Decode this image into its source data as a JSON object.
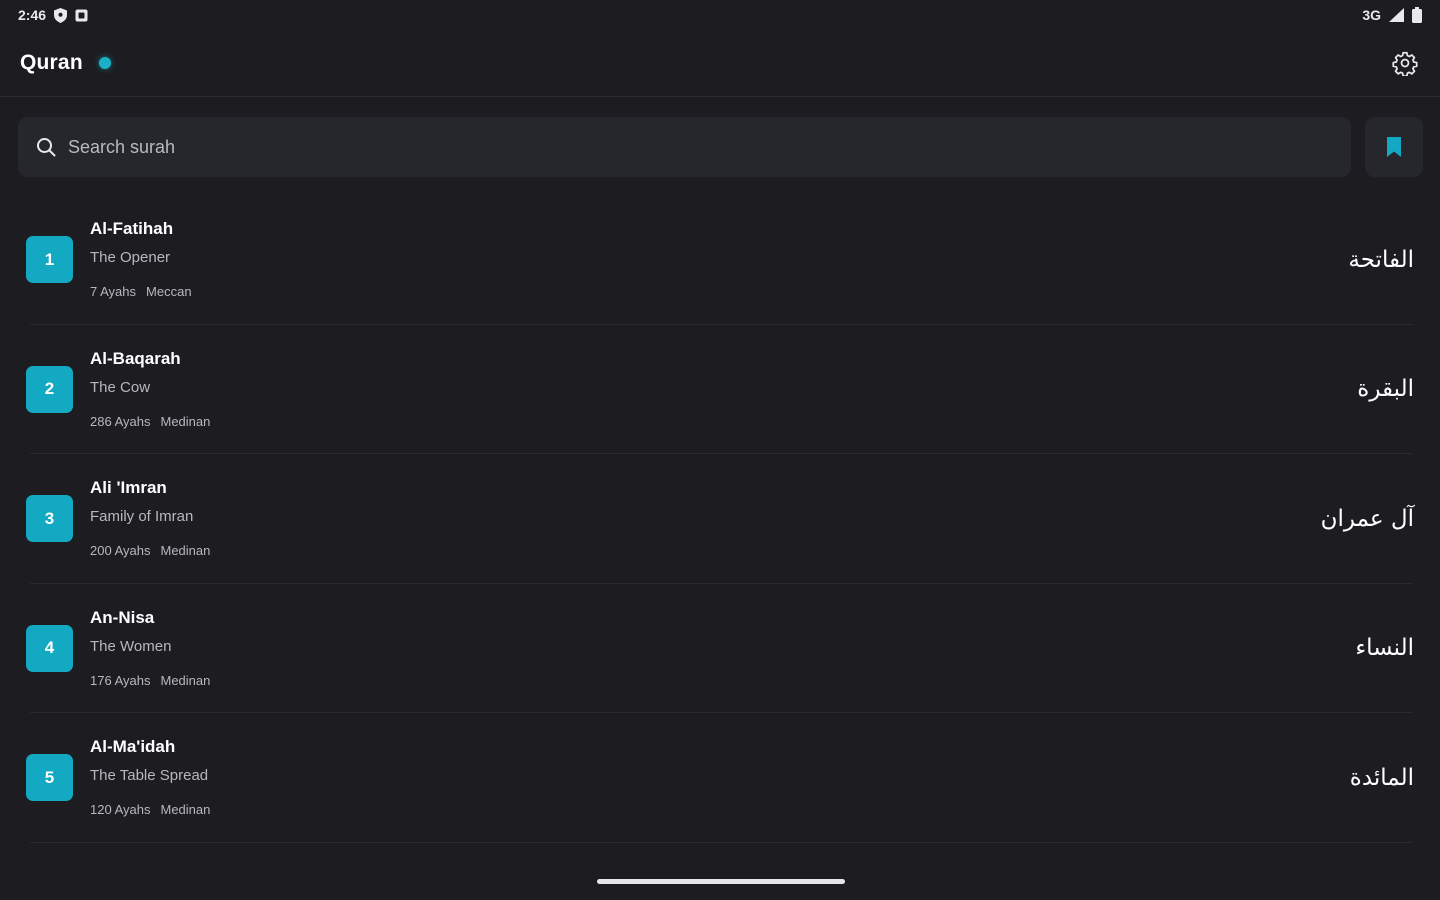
{
  "status_bar": {
    "time": "2:46",
    "network": "3G",
    "icons": [
      "shield-icon",
      "notification-square-icon",
      "signal-icon",
      "battery-icon"
    ]
  },
  "header": {
    "title": "Quran",
    "settings_icon": "gear-icon"
  },
  "search": {
    "placeholder": "Search surah",
    "value": "",
    "icon": "search-icon",
    "bookmark_icon": "bookmark-icon"
  },
  "surahs": [
    {
      "number": "1",
      "name": "Al-Fatihah",
      "translation": "The Opener",
      "ayahs": "7 Ayahs",
      "revelation": "Meccan",
      "arabic": "الفاتحة"
    },
    {
      "number": "2",
      "name": "Al-Baqarah",
      "translation": "The Cow",
      "ayahs": "286 Ayahs",
      "revelation": "Medinan",
      "arabic": "البقرة"
    },
    {
      "number": "3",
      "name": "Ali 'Imran",
      "translation": "Family of Imran",
      "ayahs": "200 Ayahs",
      "revelation": "Medinan",
      "arabic": "آل عمران"
    },
    {
      "number": "4",
      "name": "An-Nisa",
      "translation": "The Women",
      "ayahs": "176 Ayahs",
      "revelation": "Medinan",
      "arabic": "النساء"
    },
    {
      "number": "5",
      "name": "Al-Ma'idah",
      "translation": "The Table Spread",
      "ayahs": "120 Ayahs",
      "revelation": "Medinan",
      "arabic": "المائدة"
    }
  ],
  "colors": {
    "background": "#1d1d21",
    "surface": "#26272c",
    "accent": "#14a9c2",
    "text_primary": "#ffffff",
    "text_secondary": "#b7b7be"
  }
}
